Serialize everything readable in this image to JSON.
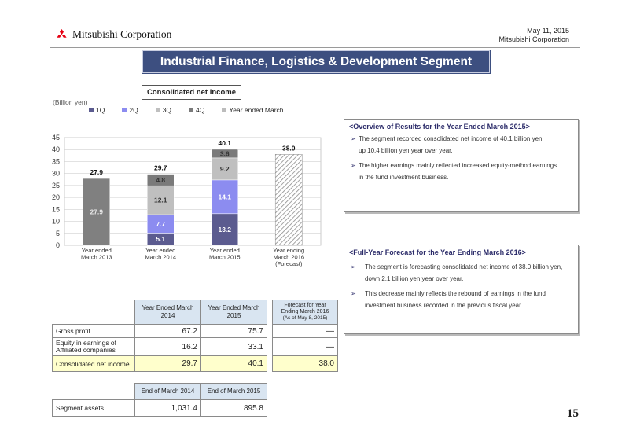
{
  "header": {
    "company": "Mitsubishi Corporation",
    "date": "May 11, 2015",
    "company_sub": "Mitsubishi Corporation",
    "title": "Industrial Finance, Logistics & Development Segment"
  },
  "chart_data": {
    "type": "bar",
    "title": "Consolidated net Income",
    "unit_label": "(Billion yen)",
    "categories": [
      "Year ended\nMarch 2013",
      "Year ended\nMarch 2014",
      "Year ended\nMarch 2015",
      "Year ending\nMarch 2016\n(Forecast)"
    ],
    "category_lines": [
      [
        "Year ended",
        "March 2013"
      ],
      [
        "Year ended",
        "March 2014"
      ],
      [
        "Year ended",
        "March 2015"
      ],
      [
        "Year ending",
        "March 2016",
        "(Forecast)"
      ]
    ],
    "series": [
      {
        "name": "1Q",
        "color": "#5b5b8f",
        "values": [
          null,
          5.1,
          13.2,
          null
        ]
      },
      {
        "name": "2Q",
        "color": "#8c8cf0",
        "values": [
          null,
          7.7,
          14.1,
          null
        ]
      },
      {
        "name": "3Q",
        "color": "#bfbfbf",
        "values": [
          null,
          12.1,
          9.2,
          null
        ]
      },
      {
        "name": "4Q",
        "color": "#7a7a7a",
        "values": [
          null,
          4.8,
          3.6,
          null
        ]
      },
      {
        "name": "Year ended March",
        "color": "#808080",
        "values": [
          27.9,
          null,
          null,
          null
        ]
      }
    ],
    "forecast": {
      "category_index": 3,
      "value": 38.0,
      "label": "38.0"
    },
    "totals": [
      "27.9",
      "29.7",
      "40.1",
      "38.0"
    ],
    "inner_labels": [
      {
        "cat": 0,
        "series": 4,
        "text": "27.9"
      },
      {
        "cat": 1,
        "series": 0,
        "text": "5.1"
      },
      {
        "cat": 1,
        "series": 1,
        "text": "7.7"
      },
      {
        "cat": 1,
        "series": 2,
        "text": "12.1"
      },
      {
        "cat": 1,
        "series": 3,
        "text": "4.8"
      },
      {
        "cat": 2,
        "series": 0,
        "text": "13.2"
      },
      {
        "cat": 2,
        "series": 1,
        "text": "14.1"
      },
      {
        "cat": 2,
        "series": 2,
        "text": "9.2"
      },
      {
        "cat": 2,
        "series": 3,
        "text": "3.6"
      }
    ],
    "ylim": [
      0,
      45
    ],
    "yticks": [
      0,
      5,
      10,
      15,
      20,
      25,
      30,
      35,
      40,
      45
    ],
    "grid": true,
    "legend_position": "top"
  },
  "overview": {
    "title": "<Overview of Results for the Year Ended March 2015>",
    "bullets": [
      {
        "line1": "The segment recorded consolidated net income of 40.1 billion yen,",
        "line2": "up 10.4 billion yen year over year."
      },
      {
        "line1": "The higher earnings mainly reflected increased equity-method earnings",
        "line2": "in the fund investment business."
      }
    ]
  },
  "forecast_box": {
    "title": "<Full-Year Forecast for the Year Ending March 2016>",
    "bullets": [
      {
        "line1": "The segment is forecasting consolidated net income of 38.0 billion yen,",
        "line2": "down 2.1 billion yen year over year."
      },
      {
        "line1": "This decrease mainly reflects the rebound of earnings in the fund",
        "line2": "investment business recorded in the previous fiscal year."
      }
    ]
  },
  "table1": {
    "col1": "Year Ended March 2014",
    "col2": "Year Ended March 2015",
    "col3": "Forecast for Year Ending March 2016",
    "col3_note": "(As of May 8, 2015)",
    "rows": [
      {
        "label": "Gross profit",
        "v1": "67.2",
        "v2": "75.7",
        "v3": "—"
      },
      {
        "label": "Equity in earnings of Affiliated companies",
        "v1": "16.2",
        "v2": "33.1",
        "v3": "—"
      },
      {
        "label": "Consolidated net income",
        "v1": "29.7",
        "v2": "40.1",
        "v3": "38.0"
      }
    ]
  },
  "table2": {
    "col1": "End of March 2014",
    "col2": "End of March 2015",
    "row": {
      "label": "Segment assets",
      "v1": "1,031.4",
      "v2": "895.8"
    }
  },
  "page_number": "15"
}
